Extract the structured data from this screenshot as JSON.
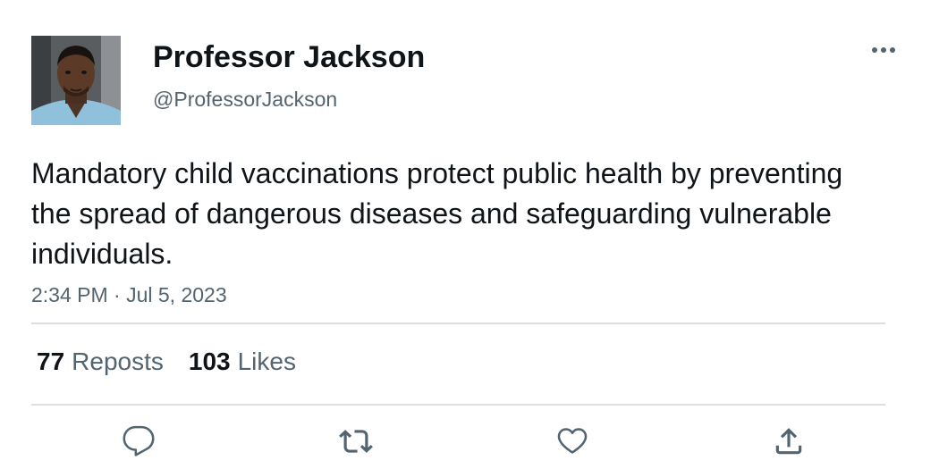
{
  "author": {
    "display_name": "Professor Jackson",
    "handle": "@ProfessorJackson",
    "avatar_icon": "profile-photo"
  },
  "tweet": {
    "text": "Mandatory child vaccinations protect public health by preventing the spread of dangerous diseases and safeguarding vulnerable individuals.",
    "timestamp": "2:34 PM · Jul 5, 2023"
  },
  "stats": {
    "reposts_count": "77",
    "reposts_label": "Reposts",
    "likes_count": "103",
    "likes_label": "Likes"
  },
  "actions": {
    "more_icon": "more-horizontal-icon",
    "reply_icon": "reply-icon",
    "repost_icon": "repost-icon",
    "like_icon": "heart-icon",
    "share_icon": "share-icon"
  },
  "colors": {
    "text_primary": "#0f1419",
    "text_secondary": "#536471",
    "divider": "#dcdfe2"
  }
}
